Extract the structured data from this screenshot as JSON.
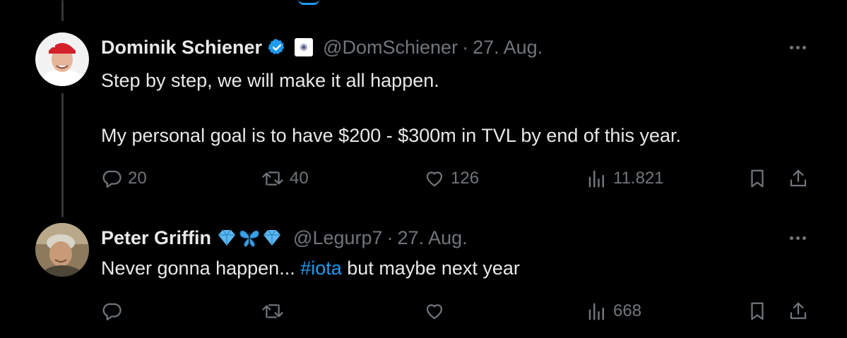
{
  "tweets": [
    {
      "author": "Dominik Schiener",
      "handle": "@DomSchiener",
      "date": "27. Aug.",
      "separator": "·",
      "verified": true,
      "text_lines": [
        "Step by step, we will make it all happen.",
        "My personal goal is to have $200 - $300m in TVL by end of this year."
      ],
      "stats": {
        "replies": "20",
        "reposts": "40",
        "likes": "126",
        "views": "11.821"
      }
    },
    {
      "author": "Peter Griffin",
      "handle": "@Legurp7",
      "date": "27. Aug.",
      "separator": "·",
      "name_emojis": [
        "gem-emoji",
        "butterfly-emoji",
        "gem-emoji"
      ],
      "text_before": "Never gonna happen... ",
      "hashtag": "#iota",
      "text_after": " but maybe next year",
      "stats": {
        "views": "668"
      }
    }
  ],
  "colors": {
    "background": "#000000",
    "text": "#e7e9ea",
    "muted": "#71767b",
    "accent": "#1d9bf0"
  },
  "icons": [
    "reply-icon",
    "repost-icon",
    "like-icon",
    "views-icon",
    "bookmark-icon",
    "share-icon",
    "more-icon",
    "verified-icon"
  ]
}
